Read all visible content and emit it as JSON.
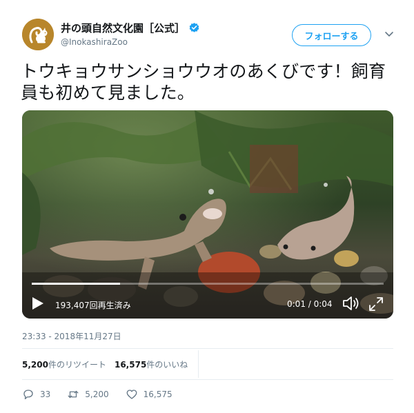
{
  "user": {
    "display_name": "井の頭自然文化園［公式］",
    "handle": "@InokashiraZoo",
    "verified": true,
    "follow_label": "フォローする"
  },
  "tweet": {
    "text": "トウキョウサンショウウオのあくびです！飼育員も初めて見ました。",
    "timestamp": "23:33 - 2018年11月27日"
  },
  "video": {
    "views": "193,407回再生済み",
    "time": "0:01 / 0:04",
    "progress_fraction": 0.25
  },
  "stats": {
    "retweets_count": "5,200",
    "retweets_suffix": "件のリツイート",
    "likes_count": "16,575",
    "likes_suffix": "件のいいね"
  },
  "actions": {
    "replies": "33",
    "retweets": "5,200",
    "likes": "16,575"
  },
  "colors": {
    "accent": "#1da1f2",
    "secondary_text": "#657786",
    "avatar_bg": "#b8862b"
  }
}
